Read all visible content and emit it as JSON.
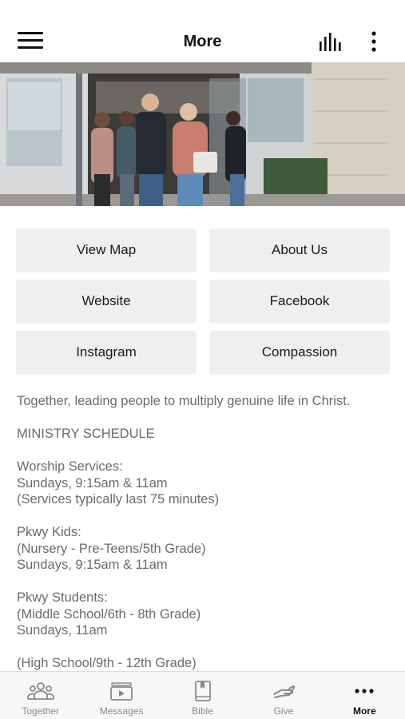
{
  "header": {
    "title": "More"
  },
  "actions": [
    {
      "label": "View Map"
    },
    {
      "label": "About Us"
    },
    {
      "label": "Website"
    },
    {
      "label": "Facebook"
    },
    {
      "label": "Instagram"
    },
    {
      "label": "Compassion"
    }
  ],
  "description": {
    "lines": [
      [
        "Together, leading people to multiply genuine life in Christ."
      ],
      [
        "MINISTRY SCHEDULE"
      ],
      [
        "Worship Services:",
        "Sundays, 9:15am & 11am",
        "(Services typically last 75 minutes)"
      ],
      [
        "Pkwy Kids:",
        "(Nursery - Pre-Teens/5th Grade)",
        "Sundays, 9:15am & 11am"
      ],
      [
        "Pkwy Students:",
        "(Middle School/6th - 8th Grade)",
        "Sundays, 11am"
      ],
      [
        "(High School/9th - 12th Grade)"
      ]
    ]
  },
  "tabs": [
    {
      "label": "Together",
      "icon": "group-icon"
    },
    {
      "label": "Messages",
      "icon": "play-video-icon"
    },
    {
      "label": "Bible",
      "icon": "bible-icon"
    },
    {
      "label": "Give",
      "icon": "give-hand-icon"
    },
    {
      "label": "More",
      "icon": "more-dots-icon",
      "active": true
    }
  ],
  "colors": {
    "button_bg": "#eeeff0",
    "text_muted": "#6b6b6b",
    "tab_inactive": "#8a8a8a",
    "tab_active": "#111111"
  }
}
